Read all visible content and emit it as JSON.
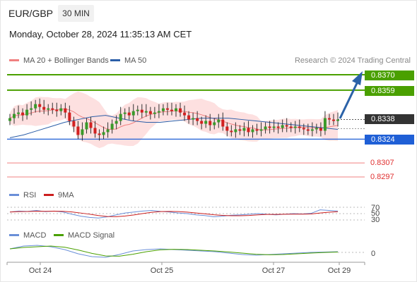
{
  "header": {
    "symbol": "EUR/GBP",
    "timeframe": "30 MIN",
    "datetime": "Monday, October 28, 2024 11:35:13 AM CET"
  },
  "legend": {
    "ma20_bb": "MA 20 + Bollinger Bands",
    "ma50": "MA 50",
    "copyright": "Research © 2024 Trading Central",
    "rsi": "RSI",
    "ma9": "9MA",
    "macd": "MACD",
    "macd_signal": "MACD Signal"
  },
  "colors": {
    "ma20": "#f08080",
    "ma50": "#2b5ea8",
    "bollinger_fill": "#fde0e0",
    "resistance": "#4aa000",
    "support": "#1f5fd6",
    "minor_support": "#f08080",
    "current": "#333333",
    "arrow": "#2b62a8",
    "rsi": "#6a8fd8",
    "ma9": "#cc1f1f",
    "macd": "#6a8fd8",
    "macd_signal": "#4aa000",
    "candle_up": "#3a9a2a",
    "candle_down": "#d22020"
  },
  "price_levels": {
    "r2": "0.8370",
    "r1": "0.8359",
    "current": "0.8338",
    "s1": "0.8324",
    "s2": "0.8307",
    "s3": "0.8297"
  },
  "oscillators": {
    "rsi_levels": [
      "70",
      "50",
      "30"
    ],
    "macd_zero": "0"
  },
  "x_axis": {
    "ticks": [
      "Oct 24",
      "Oct 25",
      "Oct 27",
      "Oct 29"
    ]
  },
  "chart_data": {
    "type": "candlestick",
    "price_range": [
      0.829,
      0.838
    ],
    "close_series": [
      0.8339,
      0.8342,
      0.8343,
      0.8341,
      0.8345,
      0.8346,
      0.8349,
      0.8347,
      0.8345,
      0.8346,
      0.8345,
      0.8344,
      0.8346,
      0.8343,
      0.8337,
      0.8333,
      0.8327,
      0.8331,
      0.8336,
      0.8332,
      0.8328,
      0.8327,
      0.8329,
      0.8331,
      0.8335,
      0.8337,
      0.8342,
      0.8343,
      0.8341,
      0.8344,
      0.8345,
      0.8343,
      0.8344,
      0.8342,
      0.8343,
      0.8344,
      0.8346,
      0.8345,
      0.8344,
      0.8346,
      0.8343,
      0.8341,
      0.8338,
      0.8339,
      0.8337,
      0.8335,
      0.8337,
      0.8334,
      0.8336,
      0.8338,
      0.8333,
      0.833,
      0.8329,
      0.8331,
      0.833,
      0.8332,
      0.8329,
      0.8331,
      0.833,
      0.8331,
      0.8333,
      0.8332,
      0.8333,
      0.8332,
      0.8334,
      0.8333,
      0.8332,
      0.8333,
      0.8332,
      0.8331,
      0.833,
      0.8331,
      0.8332,
      0.833,
      0.8339,
      0.8338,
      0.8337,
      0.8338
    ],
    "ma50_series": [
      0.8325,
      0.8327,
      0.833,
      0.8333,
      0.8336,
      0.8338,
      0.834,
      0.8341,
      0.8339,
      0.8337,
      0.8336,
      0.8336,
      0.8337,
      0.8338,
      0.8339,
      0.8339,
      0.8339,
      0.8338,
      0.8337,
      0.8336,
      0.8335,
      0.8334,
      0.8333,
      0.8332,
      0.8331
    ],
    "rsi_series": [
      55,
      58,
      57,
      60,
      56,
      58,
      55,
      48,
      42,
      38,
      36,
      40,
      46,
      52,
      55,
      58,
      60,
      57,
      55,
      52,
      50,
      46,
      44,
      40,
      42,
      45,
      46,
      48,
      50,
      48,
      46,
      48,
      50,
      49,
      51,
      62,
      60,
      58
    ],
    "macd_series": [
      0.5,
      0.9,
      1.0,
      0.8,
      0.4,
      -0.2,
      -0.6,
      -0.7,
      -0.3,
      0.2,
      0.4,
      0.5,
      0.4,
      0.3,
      0.2,
      0.1,
      -0.1,
      -0.3,
      -0.4,
      -0.3,
      -0.2,
      -0.1,
      0.0,
      0.05,
      0.1
    ]
  }
}
